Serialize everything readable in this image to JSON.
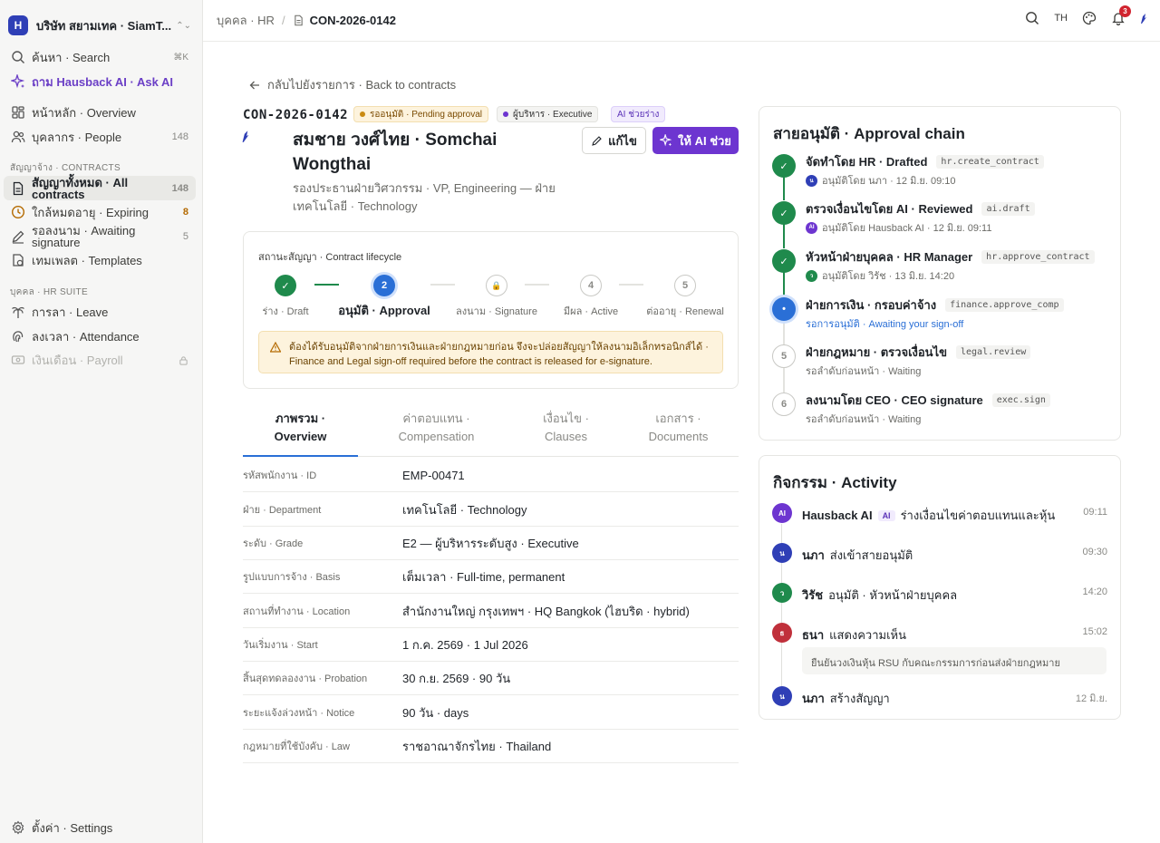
{
  "workspace": {
    "logo": "H",
    "name": "บริษัท สยามเทค · SiamT..."
  },
  "sidebar": {
    "search_label": "ค้นหา · Search",
    "search_kbd": "⌘K",
    "ask_ai": "ถาม Hausback AI · Ask AI",
    "overview": "หน้าหลัก · Overview",
    "people": "บุคลากร · People",
    "people_count": "148",
    "contracts_section": "สัญญาจ้าง · CONTRACTS",
    "all_contracts": "สัญญาทั้งหมด · All contracts",
    "all_contracts_count": "148",
    "expiring": "ใกล้หมดอายุ · Expiring",
    "expiring_count": "8",
    "awaiting": "รอลงนาม · Awaiting signature",
    "awaiting_count": "5",
    "templates": "เทมเพลต · Templates",
    "hr_section": "บุคคล · HR SUITE",
    "leave": "การลา · Leave",
    "attendance": "ลงเวลา · Attendance",
    "payroll": "เงินเดือน · Payroll",
    "settings": "ตั้งค่า · Settings"
  },
  "topbar": {
    "crumb_parent": "บุคคล · HR",
    "crumb_sep": "/",
    "crumb_current": "CON-2026-0142",
    "lang": "TH",
    "notif_count": "3"
  },
  "contract": {
    "back": "กลับไปยังรายการ · Back to contracts",
    "id": "CON-2026-0142",
    "status_pill": "รออนุมัติ · Pending approval",
    "grade_pill": "ผู้บริหาร · Executive",
    "ai_pill": "AI ช่วยร่าง",
    "name": "สมชาย วงศ์ไทย · Somchai Wongthai",
    "role": "รองประธานฝ่ายวิศวกรรม · VP, Engineering — ฝ่ายเทคโนโลยี · Technology",
    "edit_btn": "แก้ไข",
    "ai_btn": "ให้ AI ช่วย",
    "colors": {
      "accent": "#6d35d0",
      "done": "#1f8a4c",
      "current": "#2a6fd6",
      "warn_bg": "#fdf3dd"
    }
  },
  "lifecycle": {
    "title": "สถานะสัญญา · Contract lifecycle",
    "steps": [
      {
        "mark": "✓",
        "label": "ร่าง · Draft"
      },
      {
        "mark": "2",
        "label": "อนุมัติ · Approval"
      },
      {
        "mark": "🔒",
        "label": "ลงนาม · Signature"
      },
      {
        "mark": "4",
        "label": "มีผล · Active"
      },
      {
        "mark": "5",
        "label": "ต่ออายุ · Renewal"
      }
    ],
    "warning": "ต้องได้รับอนุมัติจากฝ่ายการเงินและฝ่ายกฎหมายก่อน จึงจะปล่อยสัญญาให้ลงนามอิเล็กทรอนิกส์ได้ · Finance and Legal sign-off required before the contract is released for e-signature."
  },
  "tabs": [
    {
      "th": "ภาพรวม ·",
      "en": "Overview"
    },
    {
      "th": "ค่าตอบแทน ·",
      "en": "Compensation"
    },
    {
      "th": "เงื่อนไข ·",
      "en": "Clauses"
    },
    {
      "th": "เอกสาร ·",
      "en": "Documents"
    }
  ],
  "details": [
    {
      "k": "รหัสพนักงาน · ID",
      "v": "EMP-00471"
    },
    {
      "k": "ฝ่าย · Department",
      "v": "เทคโนโลยี · Technology"
    },
    {
      "k": "ระดับ · Grade",
      "v": "E2 — ผู้บริหารระดับสูง · Executive"
    },
    {
      "k": "รูปแบบการจ้าง · Basis",
      "v": "เต็มเวลา · Full-time, permanent"
    },
    {
      "k": "สถานที่ทำงาน · Location",
      "v": "สำนักงานใหญ่ กรุงเทพฯ · HQ Bangkok (ไฮบริด · hybrid)"
    },
    {
      "k": "วันเริ่มงาน · Start",
      "v": "1 ก.ค. 2569 · 1 Jul 2026"
    },
    {
      "k": "สิ้นสุดทดลองงาน · Probation",
      "v": "30 ก.ย. 2569 · 90 วัน"
    },
    {
      "k": "ระยะแจ้งล่วงหน้า · Notice",
      "v": "90 วัน · days"
    },
    {
      "k": "กฎหมายที่ใช้บังคับ · Law",
      "v": "ราชอาณาจักรไทย · Thailand"
    }
  ],
  "approval": {
    "title": "สายอนุมัติ · Approval chain",
    "items": [
      {
        "mark": "✓",
        "title": "จัดทำโดย HR · Drafted",
        "code": "hr.create_contract",
        "avatar": "น",
        "sub": "อนุมัติโดย นภา · 12 มิ.ย. 09:10"
      },
      {
        "mark": "✓",
        "title": "ตรวจเงื่อนไขโดย AI · Reviewed",
        "code": "ai.draft",
        "avatar": "AI",
        "sub": "อนุมัติโดย Hausback AI · 12 มิ.ย. 09:11"
      },
      {
        "mark": "✓",
        "title": "หัวหน้าฝ่ายบุคคล · HR Manager",
        "code": "hr.approve_contract",
        "avatar": "ว",
        "sub": "อนุมัติโดย วิรัช · 13 มิ.ย. 14:20"
      },
      {
        "mark": "•",
        "title": "ฝ่ายการเงิน · กรอบค่าจ้าง",
        "code": "finance.approve_comp",
        "sub": "รอการอนุมัติ · Awaiting your sign-off"
      },
      {
        "mark": "5",
        "title": "ฝ่ายกฎหมาย · ตรวจเงื่อนไข",
        "code": "legal.review",
        "sub": "รอลำดับก่อนหน้า · Waiting"
      },
      {
        "mark": "6",
        "title": "ลงนามโดย CEO · CEO signature",
        "code": "exec.sign",
        "sub": "รอลำดับก่อนหน้า · Waiting"
      }
    ]
  },
  "activity": {
    "title": "กิจกรรม · Activity",
    "items": [
      {
        "avatar": "AI",
        "who": "Hausback AI",
        "tag": "AI",
        "text": "ร่างเงื่อนไขค่าตอบแทนและหุ้น",
        "time": "09:11"
      },
      {
        "avatar": "น",
        "who": "นภา",
        "text": "ส่งเข้าสายอนุมัติ",
        "time": "09:30"
      },
      {
        "avatar": "ว",
        "who": "วิรัช",
        "text": "อนุมัติ · หัวหน้าฝ่ายบุคคล",
        "time": "14:20"
      },
      {
        "avatar": "ธ",
        "who": "ธนา",
        "text": "แสดงความเห็น",
        "time": "15:02",
        "comment": "ยืนยันวงเงินหุ้น RSU กับคณะกรรมการก่อนส่งฝ่ายกฎหมาย"
      },
      {
        "avatar": "น",
        "who": "นภา",
        "text": "สร้างสัญญา",
        "time": "12 มิ.ย."
      }
    ]
  }
}
